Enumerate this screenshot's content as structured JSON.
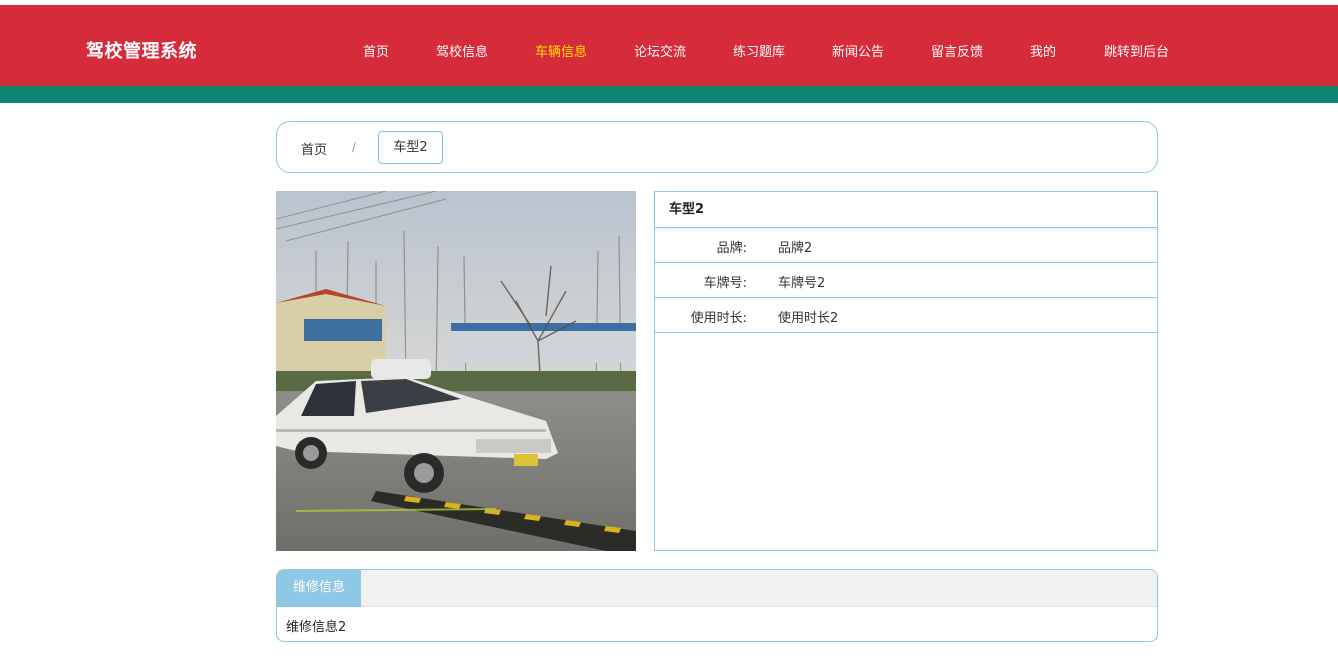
{
  "header": {
    "brand": "驾校管理系统",
    "nav": [
      {
        "label": "首页",
        "active": false
      },
      {
        "label": "驾校信息",
        "active": false
      },
      {
        "label": "车辆信息",
        "active": true
      },
      {
        "label": "论坛交流",
        "active": false
      },
      {
        "label": "练习题库",
        "active": false
      },
      {
        "label": "新闻公告",
        "active": false
      },
      {
        "label": "留言反馈",
        "active": false
      },
      {
        "label": "我的",
        "active": false
      },
      {
        "label": "跳转到后台",
        "active": false
      }
    ]
  },
  "breadcrumb": {
    "home": "首页",
    "separator": "/",
    "current": "车型2"
  },
  "detail": {
    "title": "车型2",
    "rows": [
      {
        "label": "品牌:",
        "value": "品牌2"
      },
      {
        "label": "车牌号:",
        "value": "车牌号2"
      },
      {
        "label": "使用时长:",
        "value": "使用时长2"
      }
    ]
  },
  "tabs": {
    "active_label": "维修信息",
    "content": "维修信息2"
  },
  "colors": {
    "header_red": "#d52b3b",
    "header_green": "#0e8471",
    "nav_active": "#ffe400",
    "accent_blue": "#8ec8e4"
  }
}
